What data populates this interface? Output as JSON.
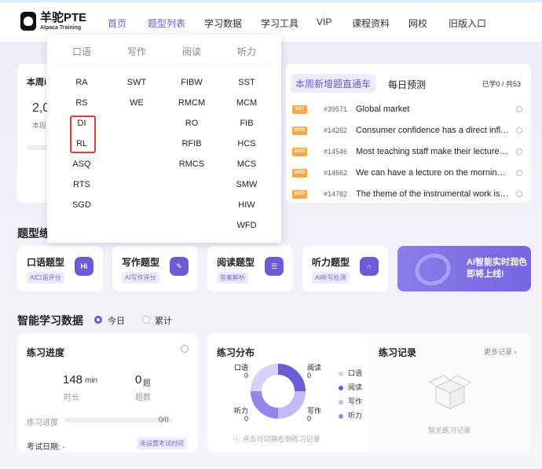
{
  "header": {
    "logo_main": "羊驼PTE",
    "logo_sub": "Alpaca Training",
    "nav": [
      "首页",
      "题型列表",
      "学习数据",
      "学习工具",
      "VIP",
      "课程资料",
      "网校",
      "旧版入口"
    ]
  },
  "dropdown": {
    "columns": [
      {
        "head": "口语",
        "items": [
          "RA",
          "RS",
          "DI",
          "RL",
          "ASQ",
          "RTS",
          "SGD"
        ]
      },
      {
        "head": "写作",
        "items": [
          "SWT",
          "WE"
        ]
      },
      {
        "head": "阅读",
        "items": [
          "FIBW",
          "RMCM",
          "RO",
          "RFIB",
          "RMCS"
        ]
      },
      {
        "head": "听力",
        "items": [
          "SST",
          "MCM",
          "FIB",
          "HCS",
          "MCS",
          "SMW",
          "HIW",
          "WFD"
        ]
      }
    ]
  },
  "week_card": {
    "title": "本周i",
    "value": "2,0",
    "sub": "本周"
  },
  "new_questions": {
    "tab_active": "本周新增题直通车",
    "tab_other": "每日预测",
    "count": "已学0 / 共53",
    "rows": [
      {
        "tag": "SST",
        "num": "#39571",
        "title": "Global market"
      },
      {
        "tag": "WFD",
        "num": "#14262",
        "title": "Consumer confidence has a direct influence on"
      },
      {
        "tag": "WFD",
        "num": "#14546",
        "title": "Most teaching staff make their lectures available"
      },
      {
        "tag": "WFD",
        "num": "#14662",
        "title": "We can have a lecture on the morning of Monday"
      },
      {
        "tag": "WFD",
        "num": "#14782",
        "title": "The theme of the instrumental work is a story"
      }
    ]
  },
  "type_section": {
    "title": "题型练",
    "cards": [
      {
        "title": "口语题型",
        "pill": "AI口语评分",
        "icon": "Hi"
      },
      {
        "title": "写作题型",
        "pill": "AI写作评分",
        "icon": "✎"
      },
      {
        "title": "阅读题型",
        "pill": "答案解析",
        "icon": "☰"
      },
      {
        "title": "听力题型",
        "pill": "AI听写检测",
        "icon": "∩"
      }
    ],
    "ai_text": "AI智能实时润色即将上线!"
  },
  "study_data": {
    "title": "智能学习数据",
    "radio_today": "今日",
    "radio_total": "累计"
  },
  "progress_card": {
    "title": "练习进度",
    "minutes": "148",
    "minutes_unit": "min",
    "minutes_label": "时长",
    "questions": "0",
    "questions_unit": "题",
    "questions_label": "题数",
    "progress_label": "练习进度",
    "progress_value": "0/0",
    "progress_fraction": 0,
    "exam_label": "考试日期: -",
    "exam_button": "未设置考试时间"
  },
  "distribution_card": {
    "title": "练习分布",
    "segments": [
      {
        "name": "口语",
        "value": "0",
        "color": "#d7d2f7"
      },
      {
        "name": "阅读",
        "value": "0",
        "color": "#6a5bd6"
      },
      {
        "name": "写作",
        "value": "0",
        "color": "#c2b9f5"
      },
      {
        "name": "听力",
        "value": "0",
        "color": "#9486e8"
      }
    ],
    "hint": "ⓘ 点击可切换右侧练习记录"
  },
  "record_card": {
    "title": "练习记录",
    "more": "更多记录 ›",
    "empty": "暂无练习记录"
  }
}
